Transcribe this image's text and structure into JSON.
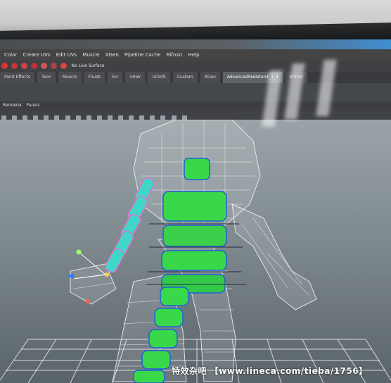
{
  "menu": [
    "Color",
    "Create UVs",
    "Edit UVs",
    "Muscle",
    "XGen",
    "Pipeline Cache",
    "Bifrost",
    "Help"
  ],
  "toolbar": {
    "no_live_surface": "No Live Surface"
  },
  "shelf_tabs": [
    "Paint Effects",
    "Toon",
    "Muscle",
    "Fluids",
    "Fur",
    "nHair",
    "nCloth",
    "Custom",
    "XGen",
    "AdvancedSkeleton4_1_4",
    "Bifrost"
  ],
  "active_shelf_tab": "AdvancedSkeleton4_1_4",
  "panel_menu": [
    "Renderer",
    "Panels"
  ],
  "watermark": "特效杂吧 【www.lineca.com/tieba/1756】",
  "colors": {
    "accent": "#3f8fd0",
    "collision_green": "#39d84a",
    "wire": "#ffffff",
    "bone_blue": "#1f5fd8"
  }
}
